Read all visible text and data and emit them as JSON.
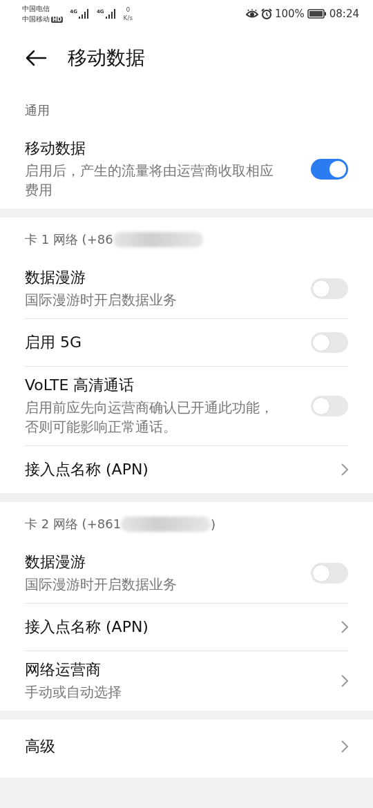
{
  "status_bar": {
    "carriers": [
      "中国电信",
      "中国移动"
    ],
    "hd_badge": "HD",
    "network_labels": [
      "4G",
      "4G"
    ],
    "speed_value": "0",
    "speed_unit": "K/s",
    "battery": "100%",
    "time": "08:24"
  },
  "header": {
    "title": "移动数据"
  },
  "sections": [
    {
      "header": {
        "text": "通用"
      },
      "items": [
        {
          "kind": "toggle",
          "title": "移动数据",
          "subtitle": "启用后，产生的流量将由运营商收取相应费用",
          "on": true
        }
      ]
    },
    {
      "header": {
        "text": "卡 1 网络 (+86",
        "redacted": true
      },
      "items": [
        {
          "kind": "toggle",
          "title": "数据漫游",
          "subtitle": "国际漫游时开启数据业务",
          "on": false
        },
        {
          "kind": "toggle",
          "title": "启用 5G",
          "on": false
        },
        {
          "kind": "toggle",
          "title": "VoLTE 高清通话",
          "subtitle": "启用前应先向运营商确认已开通此功能，否则可能影响正常通话。",
          "on": false
        },
        {
          "kind": "link",
          "title": "接入点名称 (APN)"
        }
      ]
    },
    {
      "header": {
        "text": "卡 2 网络 (+861",
        "redacted": true,
        "after": ")"
      },
      "items": [
        {
          "kind": "toggle",
          "title": "数据漫游",
          "subtitle": "国际漫游时开启数据业务",
          "on": false
        },
        {
          "kind": "link",
          "title": "接入点名称 (APN)"
        },
        {
          "kind": "link",
          "title": "网络运营商",
          "subtitle": "手动或自动选择"
        }
      ]
    },
    {
      "items": [
        {
          "kind": "link",
          "title": "高级"
        }
      ]
    }
  ]
}
